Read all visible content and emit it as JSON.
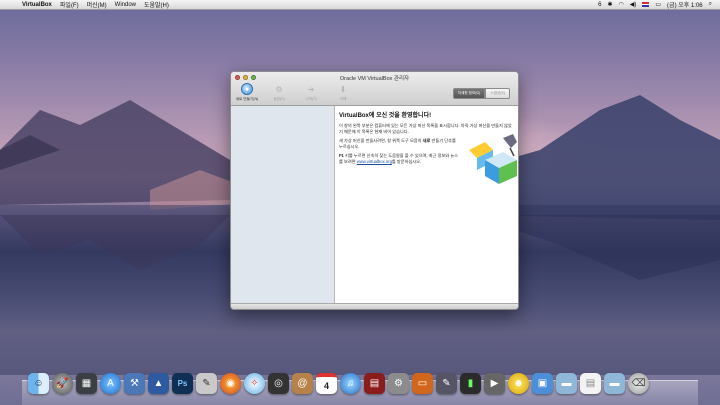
{
  "menubar": {
    "app_name": "VirtualBox",
    "items": [
      "파일(F)",
      "머신(M)",
      "Window",
      "도움말(H)"
    ],
    "status_number": "6",
    "clock": "(금) 오후 1:06"
  },
  "window": {
    "title": "Oracle VM VirtualBox 관리자",
    "toolbar": [
      {
        "label": "새로 만들기(N)",
        "icon": "new-machine-icon",
        "enabled": true
      },
      {
        "label": "설정(S)",
        "icon": "settings-gear-icon",
        "enabled": false
      },
      {
        "label": "시작(T)",
        "icon": "start-arrow-icon",
        "enabled": false
      },
      {
        "label": "삭제",
        "icon": "discard-icon",
        "enabled": false
      }
    ],
    "view_buttons": {
      "details": "자세한 정보(D)",
      "snapshots": "스냅샷(S)"
    },
    "welcome": {
      "heading": "VirtualBox에 오신 것을 환영합니다!",
      "p1": "이 창의 왼쪽 부분은 컴퓨터에 있는 모든 가상 머신 목록을 표시합니다. 아직 가상 머신을 만들지 않았기 때문에 이 목록은 현재 비어 있습니다.",
      "p2a": "새 가상 머신을 만들시려면, 창 위쪽 도구 모음의 ",
      "p2b": "새로",
      "p2c": " 만들기 단추를 누르십시오.",
      "p3a": "F1",
      "p3b": " 키를 누르면 신속히 찾는 도움말을 볼 수 있으며, 최근 정보와 뉴스를 보려면 ",
      "p3link": "www.virtualbox.org",
      "p3c": "를 방문하십시오."
    }
  },
  "dock": {
    "icons": [
      "finder-icon",
      "launchpad-icon",
      "dashboard-icon",
      "app-store-icon",
      "xcode-icon",
      "preview-icon",
      "photoshop-icon",
      "text-editor-icon",
      "firefox-icon",
      "safari-icon",
      "camera-icon",
      "contacts-icon",
      "calendar-icon",
      "itunes-icon",
      "photo-booth-icon",
      "system-preferences-icon",
      "presentation-icon",
      "paint-icon",
      "activity-monitor-icon",
      "quicktime-icon",
      "messenger-icon",
      "virtualbox-icon",
      "applications-folder-icon",
      "documents-folder-icon",
      "downloads-folder-icon",
      "trash-icon"
    ],
    "calendar_day": "4",
    "photoshop_label": "Ps"
  }
}
